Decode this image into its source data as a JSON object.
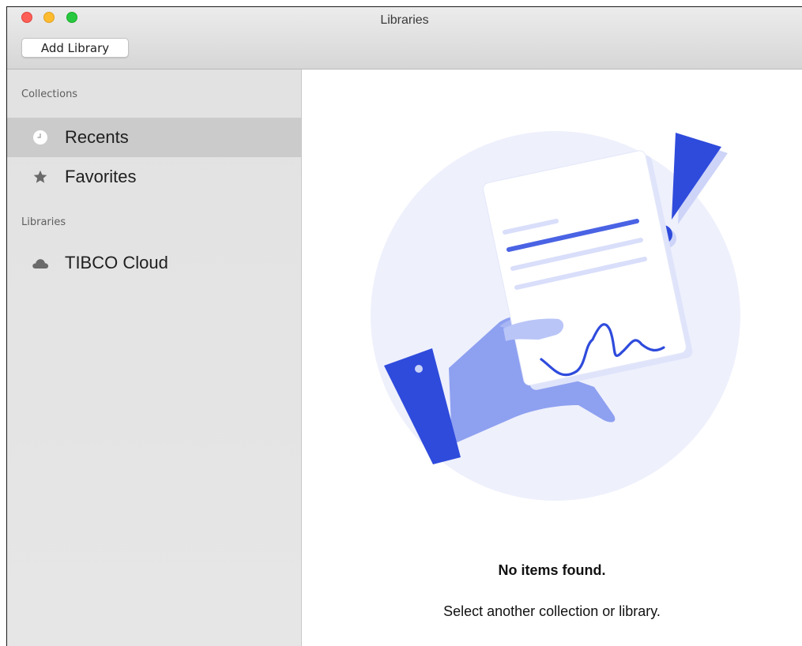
{
  "window": {
    "title": "Libraries",
    "add_library_label": "Add Library"
  },
  "sidebar": {
    "collections_header": "Collections",
    "collections": [
      {
        "label": "Recents",
        "icon": "clock-icon",
        "selected": true
      },
      {
        "label": "Favorites",
        "icon": "star-icon",
        "selected": false
      }
    ],
    "libraries_header": "Libraries",
    "libraries": [
      {
        "label": "TIBCO Cloud",
        "icon": "cloud-icon"
      }
    ]
  },
  "empty_state": {
    "title": "No items found.",
    "subtitle": "Select another collection or library."
  },
  "colors": {
    "accent": "#2f4bdc",
    "illustration_bg": "#eef0fc",
    "sidebar_selected": "#cbcbcb"
  }
}
